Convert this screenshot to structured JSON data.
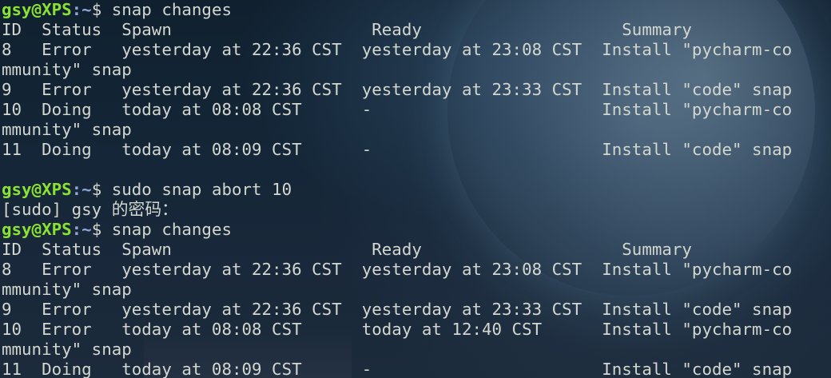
{
  "prompt": {
    "user": "gsy@XPS",
    "path": ":~",
    "symbol": "$ "
  },
  "lines": [
    {
      "type": "prompt",
      "cmd": "snap changes"
    },
    {
      "type": "text",
      "text": "ID  Status  Spawn                    Ready                    Summary"
    },
    {
      "type": "text",
      "text": "8   Error   yesterday at 22:36 CST  yesterday at 23:08 CST  Install \"pycharm-co"
    },
    {
      "type": "text",
      "text": "mmunity\" snap"
    },
    {
      "type": "text",
      "text": "9   Error   yesterday at 22:36 CST  yesterday at 23:33 CST  Install \"code\" snap"
    },
    {
      "type": "text",
      "text": "10  Doing   today at 08:08 CST      -                       Install \"pycharm-co"
    },
    {
      "type": "text",
      "text": "mmunity\" snap"
    },
    {
      "type": "text",
      "text": "11  Doing   today at 08:09 CST      -                       Install \"code\" snap"
    },
    {
      "type": "text",
      "text": ""
    },
    {
      "type": "prompt",
      "cmd": "sudo snap abort 10"
    },
    {
      "type": "text",
      "text": "[sudo] gsy 的密码："
    },
    {
      "type": "prompt",
      "cmd": "snap changes"
    },
    {
      "type": "text",
      "text": "ID  Status  Spawn                    Ready                    Summary"
    },
    {
      "type": "text",
      "text": "8   Error   yesterday at 22:36 CST  yesterday at 23:08 CST  Install \"pycharm-co"
    },
    {
      "type": "text",
      "text": "mmunity\" snap"
    },
    {
      "type": "text",
      "text": "9   Error   yesterday at 22:36 CST  yesterday at 23:33 CST  Install \"code\" snap"
    },
    {
      "type": "text",
      "text": "10  Error   today at 08:08 CST      today at 12:40 CST      Install \"pycharm-co"
    },
    {
      "type": "text",
      "text": "mmunity\" snap"
    },
    {
      "type": "text",
      "text": "11  Doing   today at 08:09 CST      -                       Install \"code\" snap"
    }
  ],
  "colors": {
    "user": "#8ae234",
    "path": "#8ea8d8",
    "text": "#d3d7cf"
  }
}
